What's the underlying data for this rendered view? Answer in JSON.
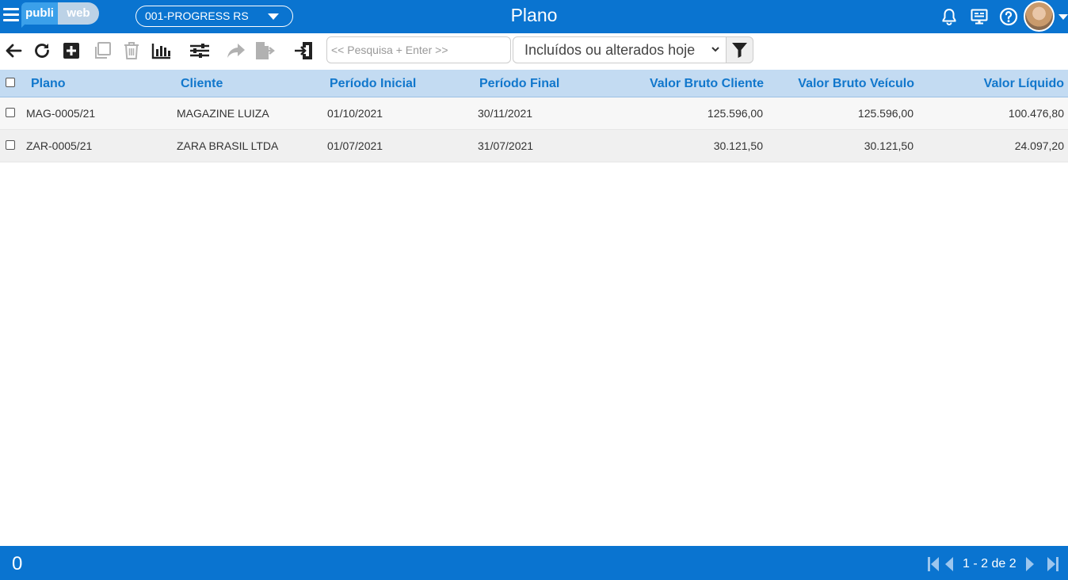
{
  "header": {
    "logo_left": "publi",
    "logo_right": "web",
    "company": "001-PROGRESS RS",
    "title": "Plano",
    "icons": [
      "menu-icon",
      "bell-icon",
      "monitor-icon",
      "help-icon",
      "avatar"
    ]
  },
  "toolbar": {
    "search_placeholder": "<< Pesquisa + Enter >>",
    "filter_value": "Incluídos ou alterados hoje",
    "icons": [
      "back-arrow-icon",
      "refresh-icon",
      "add-icon",
      "copy-icon",
      "delete-icon",
      "chart-icon",
      "settings-sliders-icon",
      "share-arrow-icon",
      "export-icon",
      "import-icon",
      "filter-icon"
    ]
  },
  "table": {
    "columns": [
      "Plano",
      "Cliente",
      "Período Inicial",
      "Período Final",
      "Valor Bruto Cliente",
      "Valor Bruto Veículo",
      "Valor Líquido"
    ],
    "rows": [
      [
        "MAG-0005/21",
        "MAGAZINE LUIZA",
        "01/10/2021",
        "30/11/2021",
        "125.596,00",
        "125.596,00",
        "100.476,80"
      ],
      [
        "ZAR-0005/21",
        "ZARA BRASIL LTDA",
        "01/07/2021",
        "31/07/2021",
        "30.121,50",
        "30.121,50",
        "24.097,20"
      ]
    ]
  },
  "footer": {
    "selected_count": "0",
    "pagination": "1 - 2 de 2"
  },
  "colors": {
    "primary": "#0a74d0",
    "header_row": "#c3dbf2",
    "column_text": "#1177cc"
  }
}
